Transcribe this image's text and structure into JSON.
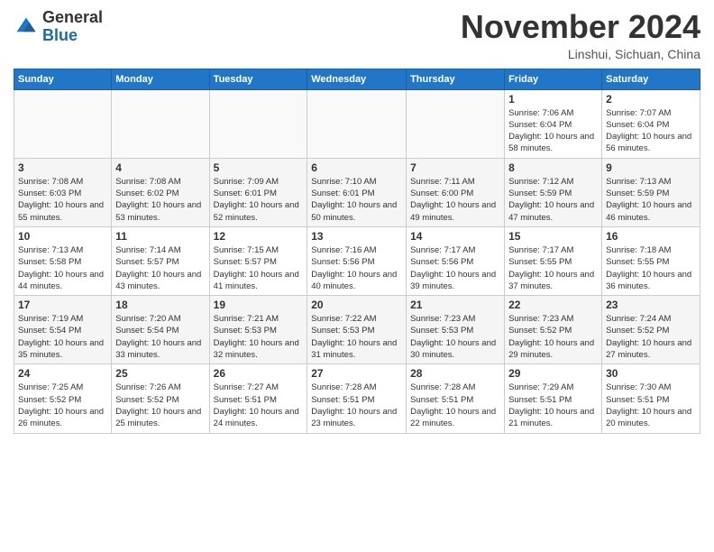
{
  "header": {
    "logo_general": "General",
    "logo_blue": "Blue",
    "month_title": "November 2024",
    "subtitle": "Linshui, Sichuan, China"
  },
  "days_of_week": [
    "Sunday",
    "Monday",
    "Tuesday",
    "Wednesday",
    "Thursday",
    "Friday",
    "Saturday"
  ],
  "weeks": [
    [
      {
        "day": "",
        "info": ""
      },
      {
        "day": "",
        "info": ""
      },
      {
        "day": "",
        "info": ""
      },
      {
        "day": "",
        "info": ""
      },
      {
        "day": "",
        "info": ""
      },
      {
        "day": "1",
        "info": "Sunrise: 7:06 AM\nSunset: 6:04 PM\nDaylight: 10 hours and 58 minutes."
      },
      {
        "day": "2",
        "info": "Sunrise: 7:07 AM\nSunset: 6:04 PM\nDaylight: 10 hours and 56 minutes."
      }
    ],
    [
      {
        "day": "3",
        "info": "Sunrise: 7:08 AM\nSunset: 6:03 PM\nDaylight: 10 hours and 55 minutes."
      },
      {
        "day": "4",
        "info": "Sunrise: 7:08 AM\nSunset: 6:02 PM\nDaylight: 10 hours and 53 minutes."
      },
      {
        "day": "5",
        "info": "Sunrise: 7:09 AM\nSunset: 6:01 PM\nDaylight: 10 hours and 52 minutes."
      },
      {
        "day": "6",
        "info": "Sunrise: 7:10 AM\nSunset: 6:01 PM\nDaylight: 10 hours and 50 minutes."
      },
      {
        "day": "7",
        "info": "Sunrise: 7:11 AM\nSunset: 6:00 PM\nDaylight: 10 hours and 49 minutes."
      },
      {
        "day": "8",
        "info": "Sunrise: 7:12 AM\nSunset: 5:59 PM\nDaylight: 10 hours and 47 minutes."
      },
      {
        "day": "9",
        "info": "Sunrise: 7:13 AM\nSunset: 5:59 PM\nDaylight: 10 hours and 46 minutes."
      }
    ],
    [
      {
        "day": "10",
        "info": "Sunrise: 7:13 AM\nSunset: 5:58 PM\nDaylight: 10 hours and 44 minutes."
      },
      {
        "day": "11",
        "info": "Sunrise: 7:14 AM\nSunset: 5:57 PM\nDaylight: 10 hours and 43 minutes."
      },
      {
        "day": "12",
        "info": "Sunrise: 7:15 AM\nSunset: 5:57 PM\nDaylight: 10 hours and 41 minutes."
      },
      {
        "day": "13",
        "info": "Sunrise: 7:16 AM\nSunset: 5:56 PM\nDaylight: 10 hours and 40 minutes."
      },
      {
        "day": "14",
        "info": "Sunrise: 7:17 AM\nSunset: 5:56 PM\nDaylight: 10 hours and 39 minutes."
      },
      {
        "day": "15",
        "info": "Sunrise: 7:17 AM\nSunset: 5:55 PM\nDaylight: 10 hours and 37 minutes."
      },
      {
        "day": "16",
        "info": "Sunrise: 7:18 AM\nSunset: 5:55 PM\nDaylight: 10 hours and 36 minutes."
      }
    ],
    [
      {
        "day": "17",
        "info": "Sunrise: 7:19 AM\nSunset: 5:54 PM\nDaylight: 10 hours and 35 minutes."
      },
      {
        "day": "18",
        "info": "Sunrise: 7:20 AM\nSunset: 5:54 PM\nDaylight: 10 hours and 33 minutes."
      },
      {
        "day": "19",
        "info": "Sunrise: 7:21 AM\nSunset: 5:53 PM\nDaylight: 10 hours and 32 minutes."
      },
      {
        "day": "20",
        "info": "Sunrise: 7:22 AM\nSunset: 5:53 PM\nDaylight: 10 hours and 31 minutes."
      },
      {
        "day": "21",
        "info": "Sunrise: 7:23 AM\nSunset: 5:53 PM\nDaylight: 10 hours and 30 minutes."
      },
      {
        "day": "22",
        "info": "Sunrise: 7:23 AM\nSunset: 5:52 PM\nDaylight: 10 hours and 29 minutes."
      },
      {
        "day": "23",
        "info": "Sunrise: 7:24 AM\nSunset: 5:52 PM\nDaylight: 10 hours and 27 minutes."
      }
    ],
    [
      {
        "day": "24",
        "info": "Sunrise: 7:25 AM\nSunset: 5:52 PM\nDaylight: 10 hours and 26 minutes."
      },
      {
        "day": "25",
        "info": "Sunrise: 7:26 AM\nSunset: 5:52 PM\nDaylight: 10 hours and 25 minutes."
      },
      {
        "day": "26",
        "info": "Sunrise: 7:27 AM\nSunset: 5:51 PM\nDaylight: 10 hours and 24 minutes."
      },
      {
        "day": "27",
        "info": "Sunrise: 7:28 AM\nSunset: 5:51 PM\nDaylight: 10 hours and 23 minutes."
      },
      {
        "day": "28",
        "info": "Sunrise: 7:28 AM\nSunset: 5:51 PM\nDaylight: 10 hours and 22 minutes."
      },
      {
        "day": "29",
        "info": "Sunrise: 7:29 AM\nSunset: 5:51 PM\nDaylight: 10 hours and 21 minutes."
      },
      {
        "day": "30",
        "info": "Sunrise: 7:30 AM\nSunset: 5:51 PM\nDaylight: 10 hours and 20 minutes."
      }
    ]
  ]
}
